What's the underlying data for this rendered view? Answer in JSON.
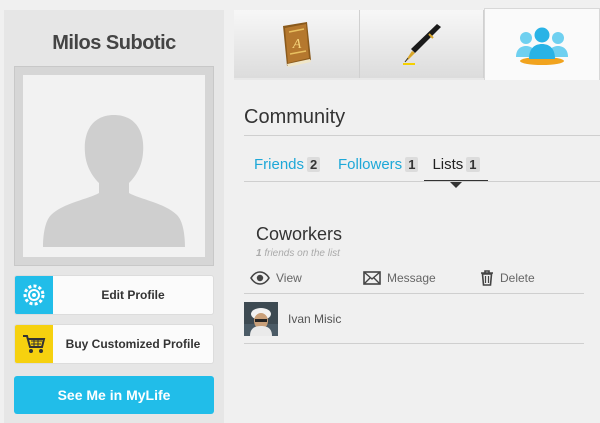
{
  "profile": {
    "name": "Milos Subotic",
    "buttons": [
      {
        "label": "Edit Profile",
        "icon": "gear-icon",
        "icon_bg": "#21bde9"
      },
      {
        "label": "Buy Customized Profile",
        "icon": "cart-icon",
        "icon_bg": "#f6d10f"
      }
    ],
    "cta_label": "See Me in MyLife",
    "cta_color": "#21bde9"
  },
  "tabs": [
    {
      "icon": "book-icon",
      "active": false
    },
    {
      "icon": "pen-icon",
      "active": false
    },
    {
      "icon": "community-icon",
      "active": true
    }
  ],
  "section": {
    "title": "Community",
    "subtabs": [
      {
        "label": "Friends",
        "count": "2",
        "active": false
      },
      {
        "label": "Followers",
        "count": "1",
        "active": false
      },
      {
        "label": "Lists",
        "count": "1",
        "active": true
      }
    ]
  },
  "list": {
    "title": "Coworkers",
    "count": "1",
    "subtitle_suffix": "friends on the list",
    "actions": [
      {
        "label": "View",
        "icon": "eye-icon"
      },
      {
        "label": "Message",
        "icon": "envelope-icon"
      },
      {
        "label": "Delete",
        "icon": "trash-icon"
      }
    ],
    "members": [
      {
        "name": "Ivan Misic"
      }
    ]
  },
  "colors": {
    "accent": "#21bde9",
    "link": "#1ea8d8",
    "yellow": "#f6d10f"
  }
}
